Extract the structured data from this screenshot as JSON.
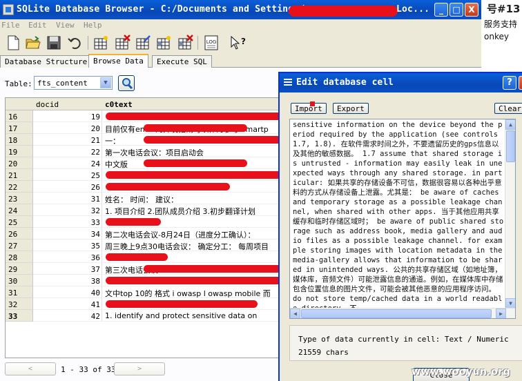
{
  "background_window": {
    "line1": "号#13",
    "line2": "服务支持",
    "line3": "onkey"
  },
  "window": {
    "title": "SQLite Database Browser - C:/Documents and Settings/",
    "title_tail": "Loc...",
    "controls": {
      "minimize": "_",
      "maximize": "□",
      "close": "X"
    }
  },
  "menu": [
    "File",
    "Edit",
    "View",
    "Help"
  ],
  "toolbar_icons": [
    "new-database-icon",
    "open-database-icon",
    "save-icon",
    "undo-icon",
    "create-table-icon",
    "delete-table-icon",
    "modify-table-icon",
    "create-index-icon",
    "delete-index-icon",
    "log-icon",
    "whats-this-icon"
  ],
  "toolbar_log_label": "LOG",
  "tabs": [
    {
      "label": "Database Structure",
      "active": false
    },
    {
      "label": "Browse Data",
      "active": true
    },
    {
      "label": "Execute SQL",
      "active": false
    }
  ],
  "browse": {
    "table_label": "Table:",
    "table_value": "fts_content",
    "columns": [
      "docid",
      "c0text"
    ],
    "rows": [
      {
        "rn": "16",
        "docid": "19",
        "text": ""
      },
      {
        "rn": "17",
        "docid": "20",
        "text": "目前仅有enisa的开发指南可以作为参考 smartp"
      },
      {
        "rn": "18",
        "docid": "21",
        "text": "一："
      },
      {
        "rn": "19",
        "docid": "22",
        "text": "第一次电话会议：项目启动会"
      },
      {
        "rn": "20",
        "docid": "24",
        "text": "中文版"
      },
      {
        "rn": "21",
        "docid": "25",
        "text": ""
      },
      {
        "rn": "22",
        "docid": "26",
        "text": ""
      },
      {
        "rn": "23",
        "docid": "31",
        "text": "姓名： 时间： 建议："
      },
      {
        "rn": "24",
        "docid": "32",
        "text": "1. 项目介绍 2.团队成员介绍 3.初步翻译计划"
      },
      {
        "rn": "25",
        "docid": "33",
        "text": ""
      },
      {
        "rn": "26",
        "docid": "34",
        "text": "第二次电话会议-8月24日（进度分工确认）："
      },
      {
        "rn": "27",
        "docid": "35",
        "text": "周三晚上9点30电话会议： 确定分工： 每周项目"
      },
      {
        "rn": "28",
        "docid": "36",
        "text": ""
      },
      {
        "rn": "29",
        "docid": "37",
        "text": "第三次电话会议"
      },
      {
        "rn": "30",
        "docid": "38",
        "text": ""
      },
      {
        "rn": "31",
        "docid": "40",
        "text": "文中top 10的 格式 i owasp l owasp mobile 而"
      },
      {
        "rn": "32",
        "docid": "41",
        "text": ""
      },
      {
        "rn": "33",
        "docid": "42",
        "text": "1. identify and protect sensitive data on"
      }
    ],
    "prev_label": "<",
    "next_label": ">",
    "page_status": "1 - 33 of 33"
  },
  "dialog": {
    "title": "Edit database cell",
    "help_btn": "?",
    "close_btn": "X",
    "import_label": "Import",
    "export_label": "Export",
    "clear_label": "Clear",
    "cell_text": "sensitive information on the device beyond the period required by the application (see controls 1.7, 1.8). 在软件需求时间之外，不要遗留历史的gps信息以及其他的敏感数据。 1.7 assume that shared storage is untrusted - information may easily leak in unexpected ways through any shared storage. in particular: 如果共享的存储设备不可信，数据很容易以各种出乎意料的方式从存储设备上泄露。尤其是： be aware of caches and temporary storage as a possible leakage channel, when shared with other apps. 当于其他应用共享缓存和临时存储区域时； be aware of public shared storage such as address book, media gallery and audio files as a possible leakage channel. for example storing images with location metadata in the media-gallery allows that information to be shared in unintended ways. 公共的共享存储区域（如地址簿，媒体库，音频文件）可能泄露信息的通道。例如，在媒体库中存储包含位置信息的图片文件，可能会被其他恶意的应用程序访问。 do not store temp/cached data in a world readable directory. 不",
    "type_line": "Type of data currently in cell: Text / Numeric",
    "size_line": "21559 chars",
    "close_label": "Close"
  },
  "watermark": "www.wooyun.org"
}
